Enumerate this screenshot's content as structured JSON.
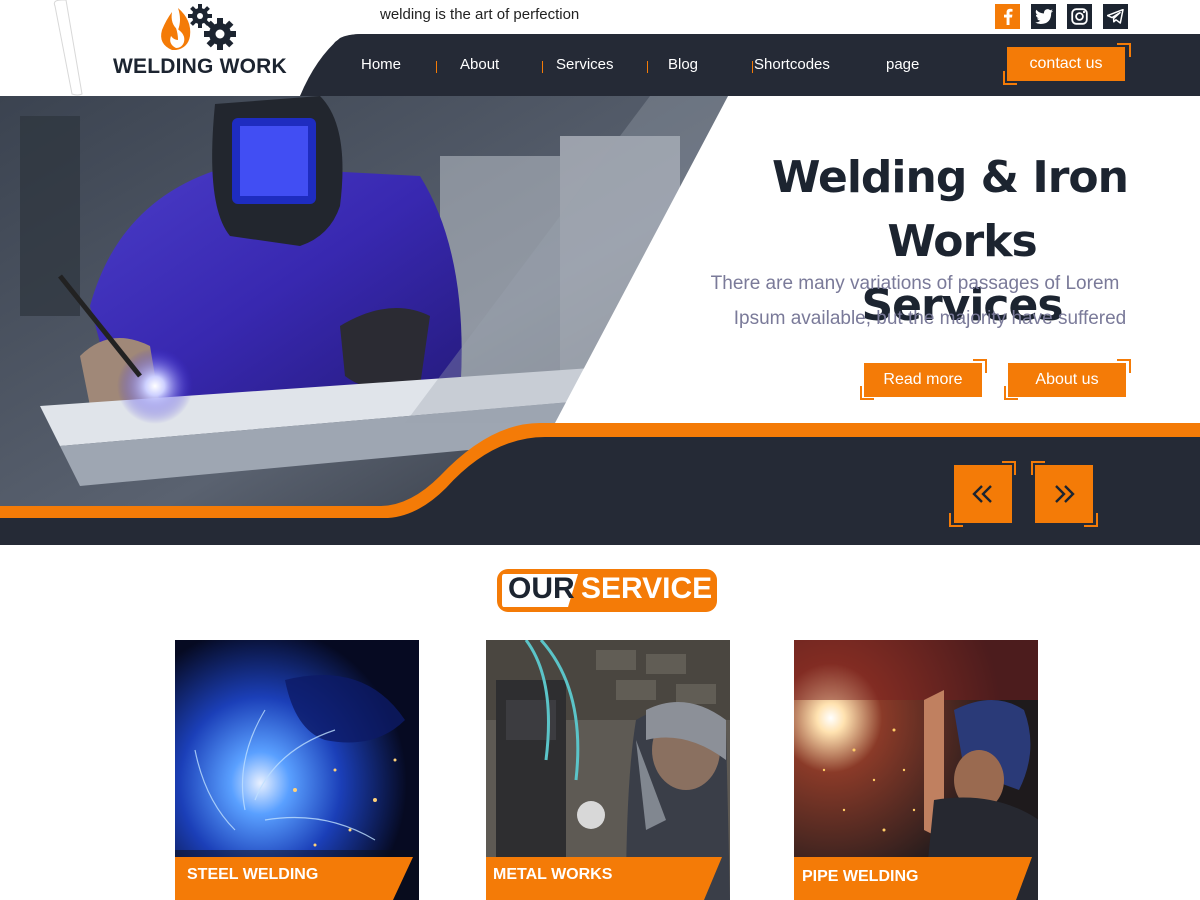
{
  "header": {
    "tagline": "welding is the art of perfection",
    "logo": "WELDING WORK",
    "social": [
      {
        "name": "facebook-icon"
      },
      {
        "name": "twitter-icon"
      },
      {
        "name": "instagram-icon"
      },
      {
        "name": "telegram-icon"
      }
    ],
    "nav": [
      "Home",
      "About",
      "Services",
      "Blog",
      "Shortcodes",
      "page"
    ],
    "contact_label": "contact us"
  },
  "hero": {
    "title_line1": "Welding & Iron",
    "title_line2": "Works Services",
    "text_line1": "There are many variations of passages of Lorem",
    "text_line2": "Ipsum available, but the majority have suffered",
    "read_more": "Read more",
    "about_us": "About us",
    "prev_icon": "double-chevron-left-icon",
    "next_icon": "double-chevron-right-icon"
  },
  "services": {
    "heading_part1": "OUR",
    "heading_part2": "SERVICE",
    "cards": [
      {
        "label": "STEEL WELDING"
      },
      {
        "label": "METAL WORKS"
      },
      {
        "label": "PIPE WELDING"
      }
    ]
  },
  "colors": {
    "accent": "#f47b07",
    "dark": "#252a36",
    "text_dark": "#1c2430"
  }
}
